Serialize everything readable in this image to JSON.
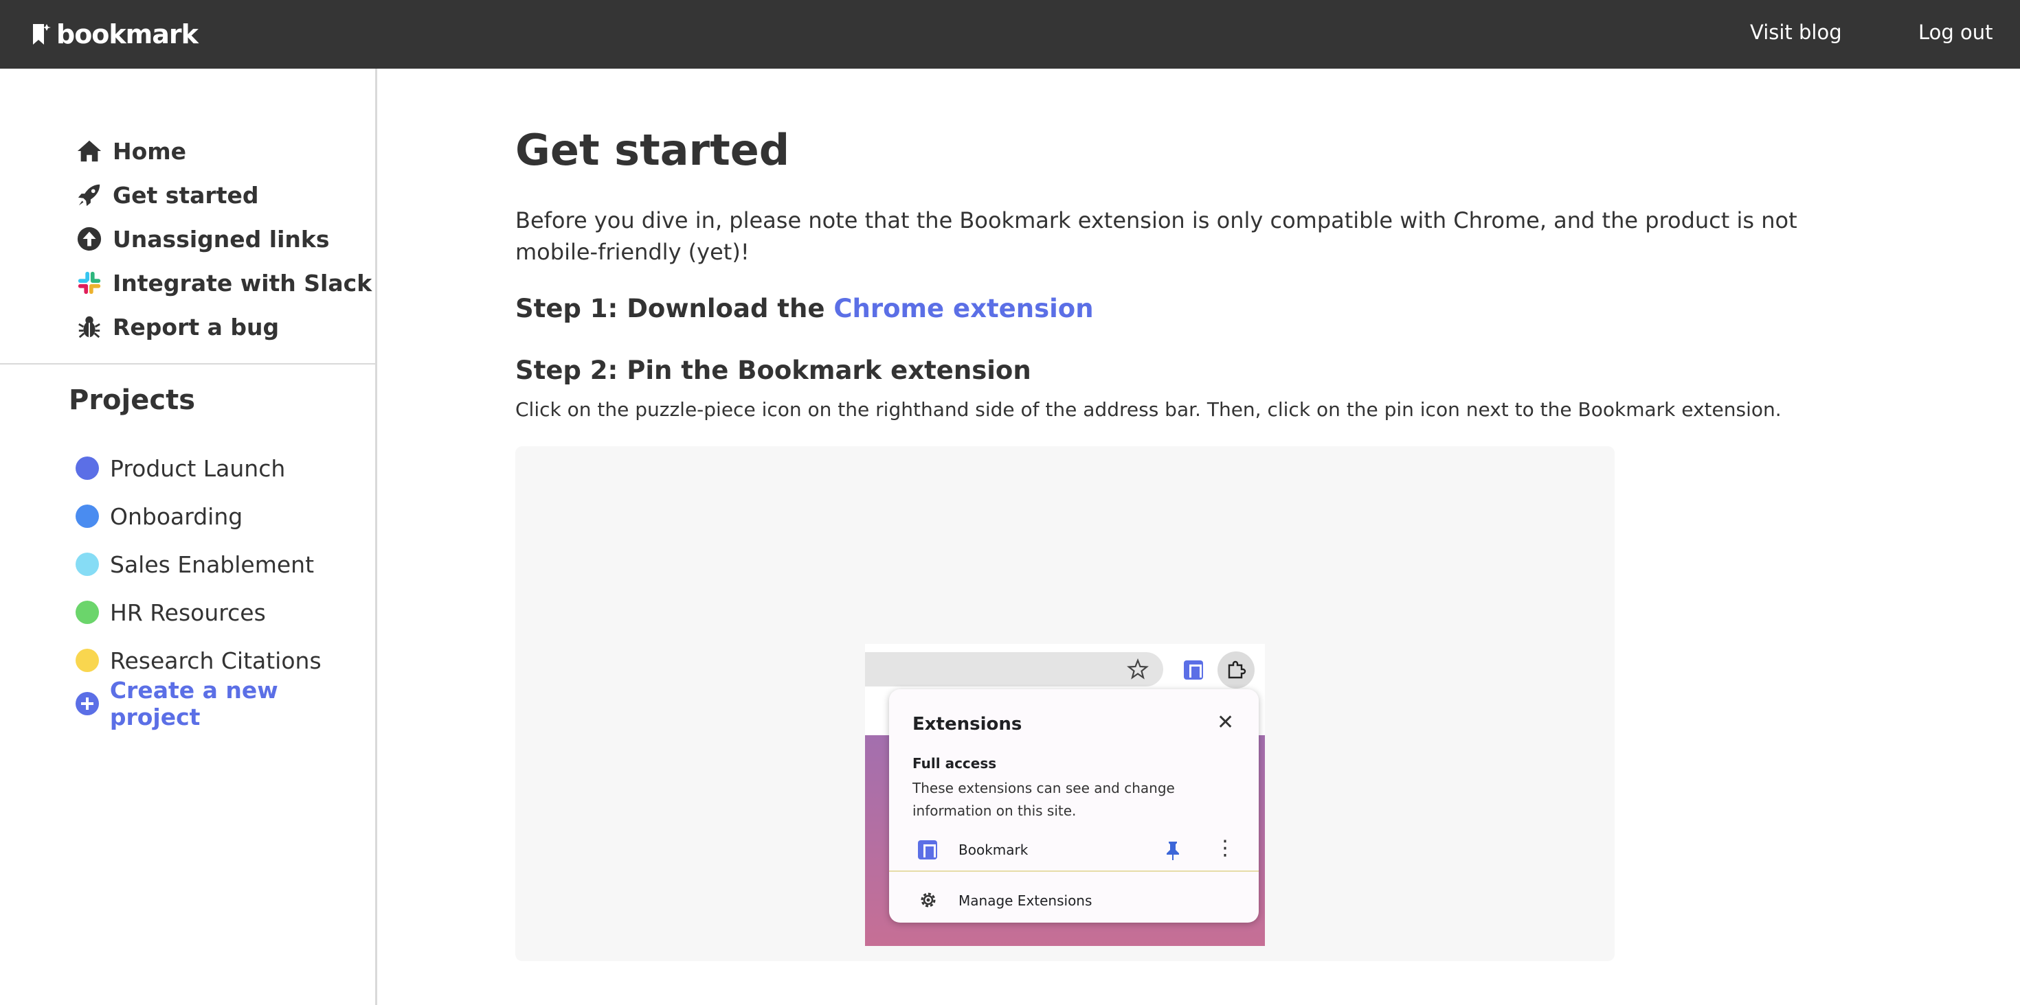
{
  "header": {
    "logo_text": "bookmark",
    "visit_blog": "Visit blog",
    "log_out": "Log out"
  },
  "sidebar": {
    "nav": [
      {
        "label": "Home",
        "icon": "home-icon"
      },
      {
        "label": "Get started",
        "icon": "rocket-icon"
      },
      {
        "label": "Unassigned links",
        "icon": "arrow-up-circle-icon"
      },
      {
        "label": "Integrate with Slack",
        "icon": "slack-icon"
      },
      {
        "label": "Report a bug",
        "icon": "bug-icon"
      }
    ],
    "projects_title": "Projects",
    "projects": [
      {
        "label": "Product Launch",
        "color": "#5b6fe6"
      },
      {
        "label": "Onboarding",
        "color": "#4a8cf0"
      },
      {
        "label": "Sales Enablement",
        "color": "#86dcf5"
      },
      {
        "label": "HR Resources",
        "color": "#6bd56b"
      },
      {
        "label": "Research Citations",
        "color": "#f9d64f"
      }
    ],
    "create_project": "Create a new project"
  },
  "main": {
    "title": "Get started",
    "intro": "Before you dive in, please note that the Bookmark extension is only compatible with Chrome, and the product is not mobile-friendly (yet)!",
    "step1_prefix": "Step 1: Download the",
    "step1_link": "Chrome extension",
    "step2_title": "Step 2: Pin the Bookmark extension",
    "step2_desc": "Click on the puzzle-piece icon on the righthand side of the address bar. Then, click on the pin icon next to the Bookmark extension.",
    "mock": {
      "popup_title": "Extensions",
      "full_access": "Full access",
      "full_access_desc": "These extensions can see and change information on this site.",
      "extension_name": "Bookmark",
      "manage": "Manage Extensions"
    }
  },
  "colors": {
    "accent": "#5b6fe6",
    "header_bg": "#353535"
  }
}
